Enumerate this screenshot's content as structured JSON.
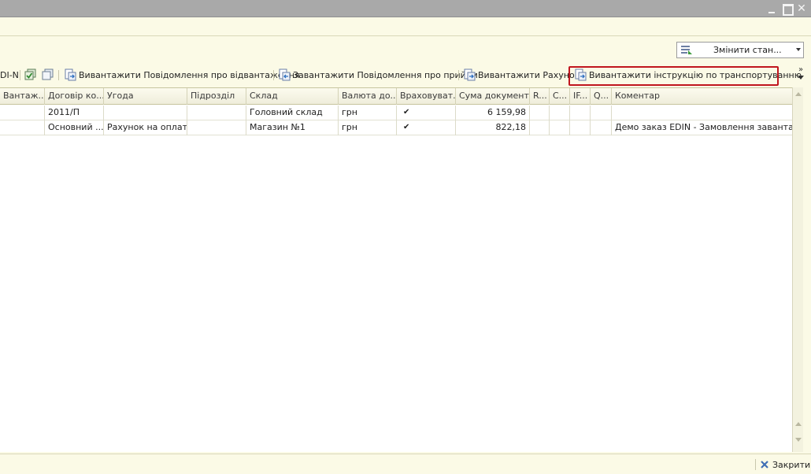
{
  "window": {
    "minimize_icon": "minimize-icon",
    "maximize_icon": "maximize-icon",
    "close_glyph": "✕"
  },
  "state_dropdown": {
    "label": "Змінити стан...",
    "icon": "state-change-icon"
  },
  "toolbar": {
    "edi_fragment": "DI-N",
    "items": [
      {
        "label": "Вивантажити Повідомлення про відвантаження",
        "icon": "export-doc-icon"
      },
      {
        "label": "Завантажити Повідомлення про прийом",
        "icon": "import-doc-icon"
      },
      {
        "label": "Вивантажити Рахунок",
        "icon": "export-doc-icon"
      },
      {
        "label": "Вивантажити інструкцію по транспортуванню",
        "icon": "export-doc-icon"
      }
    ],
    "more_glyph": "»"
  },
  "table": {
    "columns": [
      "Вантаж...",
      "Договір ко...",
      "Угода",
      "Підрозділ",
      "Склад",
      "Валюта до...",
      "Враховуват...",
      "Сума документу",
      "R...",
      "C...",
      "IF...",
      "Q...",
      "Коментар"
    ],
    "rows": [
      {
        "vantazh": "",
        "dogovir": "2011/П",
        "uhoda": "",
        "pidrozdil": "",
        "sklad": "Головний склад",
        "valuta": "грн",
        "vrakhovuvaty": "✔",
        "suma": "6 159,98",
        "r": "",
        "c": "",
        "if": "",
        "q": "",
        "komentar": ""
      },
      {
        "vantazh": "",
        "dogovir": "Основний ...",
        "uhoda": "Рахунок на оплат...",
        "pidrozdil": "",
        "sklad": "Магазин №1",
        "valuta": "грн",
        "vrakhovuvaty": "✔",
        "suma": "822,18",
        "r": "",
        "c": "",
        "if": "",
        "q": "",
        "komentar": "Демо заказ EDIN - Замовлення заванта..."
      }
    ]
  },
  "footer": {
    "close_label": "Закрити",
    "close_icon": "close-x-icon"
  },
  "colors": {
    "background": "#fbfae6",
    "highlight_border": "#c0161e",
    "titlebar": "#a9a9a9"
  }
}
